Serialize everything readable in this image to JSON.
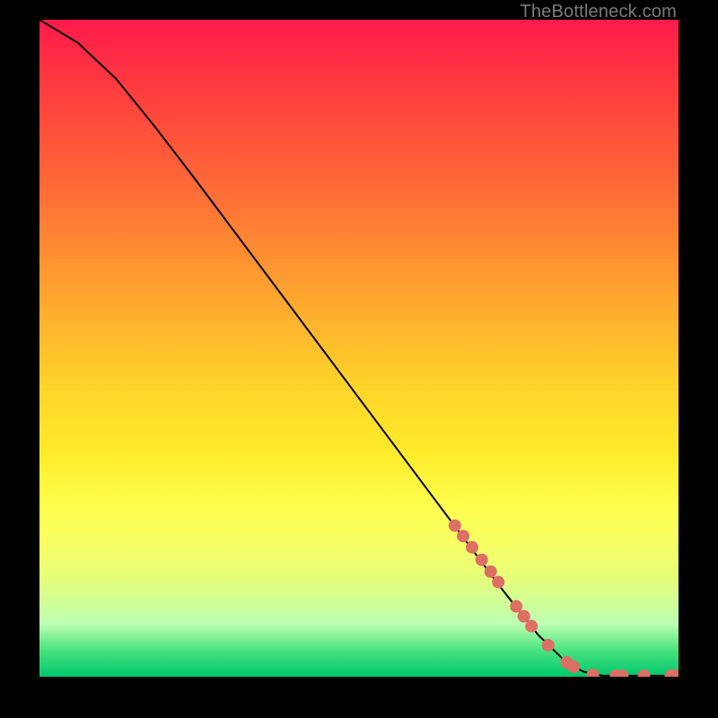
{
  "attribution": "TheBottleneck.com",
  "chart_data": {
    "type": "line",
    "title": "",
    "xlabel": "",
    "ylabel": "",
    "xlim": [
      0,
      100
    ],
    "ylim": [
      0,
      100
    ],
    "grid": false,
    "series": [
      {
        "name": "curve",
        "color": "#000000",
        "points": [
          {
            "x": 0,
            "y": 100
          },
          {
            "x": 6,
            "y": 96.5
          },
          {
            "x": 12,
            "y": 91.0
          },
          {
            "x": 18,
            "y": 83.8
          },
          {
            "x": 24,
            "y": 76.2
          },
          {
            "x": 30,
            "y": 68.4
          },
          {
            "x": 36,
            "y": 60.6
          },
          {
            "x": 42,
            "y": 52.8
          },
          {
            "x": 48,
            "y": 45.0
          },
          {
            "x": 54,
            "y": 37.2
          },
          {
            "x": 60,
            "y": 29.4
          },
          {
            "x": 66,
            "y": 21.6
          },
          {
            "x": 72,
            "y": 13.8
          },
          {
            "x": 78,
            "y": 6.4
          },
          {
            "x": 82,
            "y": 2.6
          },
          {
            "x": 85,
            "y": 0.8
          },
          {
            "x": 88,
            "y": 0.15
          },
          {
            "x": 100,
            "y": 0.15
          }
        ]
      }
    ],
    "markers": {
      "color": "#dd6f64",
      "points": [
        {
          "x": 65.0,
          "y": 23.0
        },
        {
          "x": 66.3,
          "y": 21.4
        },
        {
          "x": 67.7,
          "y": 19.7
        },
        {
          "x": 69.2,
          "y": 17.8
        },
        {
          "x": 70.6,
          "y": 16.0
        },
        {
          "x": 71.8,
          "y": 14.4
        },
        {
          "x": 74.6,
          "y": 10.7
        },
        {
          "x": 75.8,
          "y": 9.2
        },
        {
          "x": 77.0,
          "y": 7.7
        },
        {
          "x": 79.6,
          "y": 4.8
        },
        {
          "x": 82.5,
          "y": 2.2
        },
        {
          "x": 83.6,
          "y": 1.5
        },
        {
          "x": 86.6,
          "y": 0.3
        },
        {
          "x": 90.2,
          "y": 0.15
        },
        {
          "x": 91.2,
          "y": 0.15
        },
        {
          "x": 94.6,
          "y": 0.15
        },
        {
          "x": 98.8,
          "y": 0.15
        },
        {
          "x": 99.6,
          "y": 0.15
        }
      ]
    }
  }
}
